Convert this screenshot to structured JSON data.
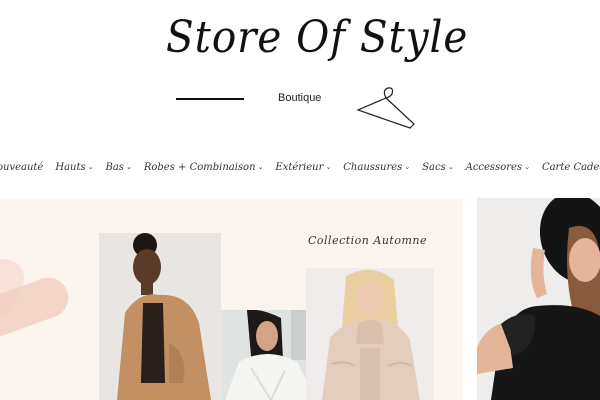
{
  "brand": {
    "name": "Store Of Style",
    "tagline": "Boutique"
  },
  "nav": {
    "items": [
      {
        "label": "Nouveauté",
        "has_dropdown": false
      },
      {
        "label": "Hauts",
        "has_dropdown": true
      },
      {
        "label": "Bas",
        "has_dropdown": true
      },
      {
        "label": "Robes + Combinaison",
        "has_dropdown": true
      },
      {
        "label": "Extérieur",
        "has_dropdown": true
      },
      {
        "label": "Chaussures",
        "has_dropdown": true
      },
      {
        "label": "Sacs",
        "has_dropdown": true
      },
      {
        "label": "Accessores",
        "has_dropdown": true
      },
      {
        "label": "Carte Cadeau",
        "has_dropdown": false
      }
    ]
  },
  "hero": {
    "collection_title": "Collection Automne"
  },
  "colors": {
    "hero_bg": "#fbf4ef",
    "accent_brush": "#f1cfc2"
  }
}
